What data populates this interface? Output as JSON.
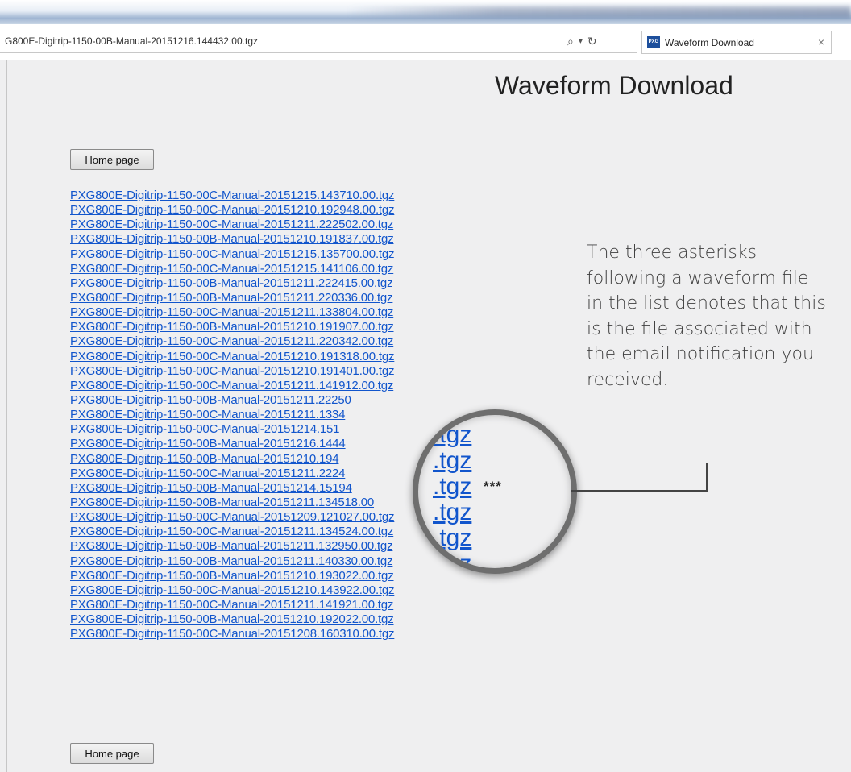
{
  "browser": {
    "address": "G800E-Digitrip-1150-00B-Manual-20151216.144432.00.tgz",
    "tab_favicon": "PXG",
    "tab_title": "Waveform Download",
    "search_icon": "⌕",
    "dropdown_icon": "▾",
    "refresh_icon": "↻",
    "close_icon": "×"
  },
  "page": {
    "title": "Waveform Download",
    "home_button": "Home page"
  },
  "files": [
    "PXG800E-Digitrip-1150-00C-Manual-20151215.143710.00.tgz",
    "PXG800E-Digitrip-1150-00C-Manual-20151210.192948.00.tgz",
    "PXG800E-Digitrip-1150-00C-Manual-20151211.222502.00.tgz",
    "PXG800E-Digitrip-1150-00B-Manual-20151210.191837.00.tgz",
    "PXG800E-Digitrip-1150-00C-Manual-20151215.135700.00.tgz",
    "PXG800E-Digitrip-1150-00C-Manual-20151215.141106.00.tgz",
    "PXG800E-Digitrip-1150-00B-Manual-20151211.222415.00.tgz",
    "PXG800E-Digitrip-1150-00B-Manual-20151211.220336.00.tgz",
    "PXG800E-Digitrip-1150-00C-Manual-20151211.133804.00.tgz",
    "PXG800E-Digitrip-1150-00B-Manual-20151210.191907.00.tgz",
    "PXG800E-Digitrip-1150-00C-Manual-20151211.220342.00.tgz",
    "PXG800E-Digitrip-1150-00C-Manual-20151210.191318.00.tgz",
    "PXG800E-Digitrip-1150-00C-Manual-20151210.191401.00.tgz",
    "PXG800E-Digitrip-1150-00C-Manual-20151211.141912.00.tgz",
    "PXG800E-Digitrip-1150-00B-Manual-20151211.22250",
    "PXG800E-Digitrip-1150-00C-Manual-20151211.1334",
    "PXG800E-Digitrip-1150-00C-Manual-20151214.151",
    "PXG800E-Digitrip-1150-00B-Manual-20151216.1444",
    "PXG800E-Digitrip-1150-00B-Manual-20151210.194",
    "PXG800E-Digitrip-1150-00C-Manual-20151211.2224",
    "PXG800E-Digitrip-1150-00B-Manual-20151214.15194",
    "PXG800E-Digitrip-1150-00B-Manual-20151211.134518.00",
    "PXG800E-Digitrip-1150-00C-Manual-20151209.121027.00.tgz",
    "PXG800E-Digitrip-1150-00C-Manual-20151211.134524.00.tgz",
    "PXG800E-Digitrip-1150-00B-Manual-20151211.132950.00.tgz",
    "PXG800E-Digitrip-1150-00B-Manual-20151211.140330.00.tgz",
    "PXG800E-Digitrip-1150-00B-Manual-20151210.193022.00.tgz",
    "PXG800E-Digitrip-1150-00C-Manual-20151210.143922.00.tgz",
    "PXG800E-Digitrip-1150-00C-Manual-20151211.141921.00.tgz",
    "PXG800E-Digitrip-1150-00B-Manual-20151210.192022.00.tgz",
    "PXG800E-Digitrip-1150-00C-Manual-20151208.160310.00.tgz"
  ],
  "magnifier_lines": [
    ".tgz",
    ".tgz",
    ".tgz",
    ".tgz",
    ".tgz",
    ".tgz"
  ],
  "marker": "***",
  "callout": "The three asterisks following a waveform file in the list denotes that this is the file associated with the email notification you received."
}
